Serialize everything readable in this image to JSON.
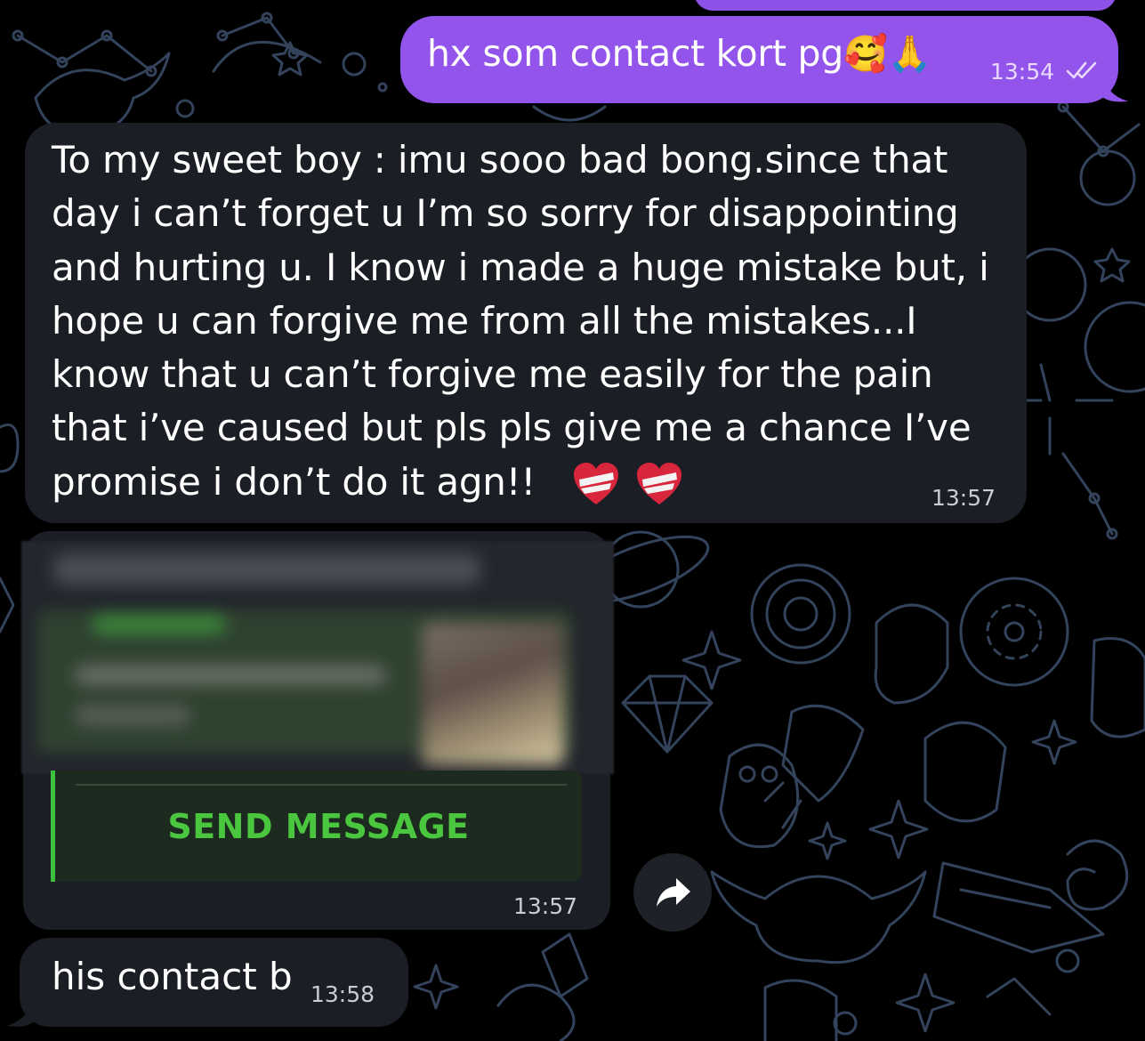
{
  "colors": {
    "background": "#000000",
    "doodle": "#3a4a63",
    "outgoing_bubble": "#9254ea",
    "incoming_bubble": "#1b1e25",
    "link_button_text": "#4bc63f",
    "link_accent_bar": "#3cc13c"
  },
  "messages": {
    "outgoing": {
      "text": "hx som contact kort pg",
      "emojis": "🥰🙏",
      "time": "13:54",
      "status_icon": "double-check-icon"
    },
    "incoming_long": {
      "text": "To my sweet boy : imu sooo bad bong.since that day i can’t forget u I’m so sorry for disappointing and hurting u. I know i made a huge mistake but, i hope u can forgive me from all the mistakes...I know that u can’t forgive me easily for the pain that i’ve caused but pls pls give me a chance I’ve promise i don’t do it agn!!",
      "emoji_icons": [
        "mending-heart-icon",
        "mending-heart-icon"
      ],
      "time": "13:57"
    },
    "incoming_link": {
      "button_label": "SEND MESSAGE",
      "time": "13:57",
      "preview_state": "blurred"
    },
    "incoming_short": {
      "text": "his contact b",
      "time": "13:58"
    }
  },
  "actions": {
    "forward_icon": "share-arrow-icon"
  }
}
